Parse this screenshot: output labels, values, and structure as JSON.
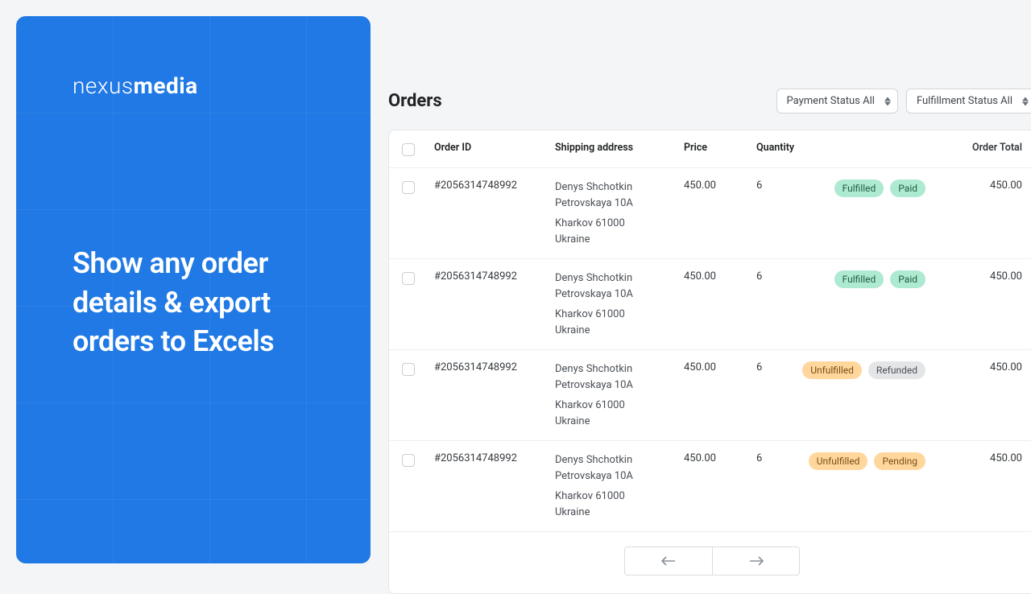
{
  "brand": {
    "left": "nexus",
    "right": "media"
  },
  "headline": "Show any order details & export orders to Excels",
  "page_title": "Orders",
  "filters": {
    "payment": "Payment Status All",
    "fulfillment": "Fulfillment Status All"
  },
  "columns": {
    "order_id": "Order ID",
    "shipping": "Shipping address",
    "price": "Price",
    "qty": "Quantity",
    "total": "Order Total"
  },
  "rows": [
    {
      "id": "#2056314748992",
      "addr1": "Denys Shchotkin",
      "addr2": "Petrovskaya 10A",
      "addr3": "Kharkov 61000",
      "addr4": "Ukraine",
      "price": "450.00",
      "qty": "6",
      "status1": {
        "text": "Fulfilled",
        "variant": "green"
      },
      "status2": {
        "text": "Paid",
        "variant": "green"
      },
      "total": "450.00"
    },
    {
      "id": "#2056314748992",
      "addr1": "Denys Shchotkin",
      "addr2": "Petrovskaya 10A",
      "addr3": "Kharkov 61000",
      "addr4": "Ukraine",
      "price": "450.00",
      "qty": "6",
      "status1": {
        "text": "Fulfilled",
        "variant": "green"
      },
      "status2": {
        "text": "Paid",
        "variant": "green"
      },
      "total": "450.00"
    },
    {
      "id": "#2056314748992",
      "addr1": "Denys Shchotkin",
      "addr2": "Petrovskaya 10A",
      "addr3": "Kharkov 61000",
      "addr4": "Ukraine",
      "price": "450.00",
      "qty": "6",
      "status1": {
        "text": "Unfulfilled",
        "variant": "yellow"
      },
      "status2": {
        "text": "Refunded",
        "variant": "gray"
      },
      "total": "450.00"
    },
    {
      "id": "#2056314748992",
      "addr1": "Denys Shchotkin",
      "addr2": "Petrovskaya 10A",
      "addr3": "Kharkov 61000",
      "addr4": "Ukraine",
      "price": "450.00",
      "qty": "6",
      "status1": {
        "text": "Unfulfilled",
        "variant": "yellow"
      },
      "status2": {
        "text": "Pending",
        "variant": "yellow"
      },
      "total": "450.00"
    }
  ]
}
